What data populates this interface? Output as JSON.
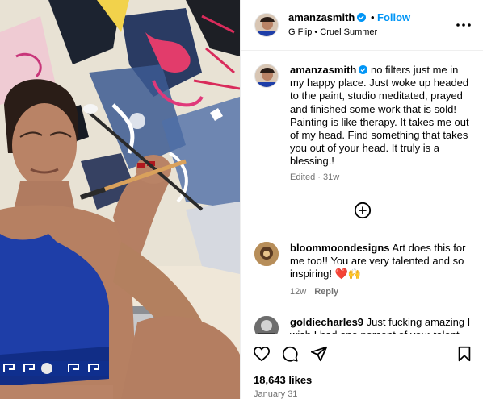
{
  "post": {
    "username": "amanzasmith",
    "follow_label": "Follow",
    "separator": "•",
    "audio": "G Flip • Cruel Summer"
  },
  "caption": {
    "username": "amanzasmith",
    "text": "no filters just me in my happy place. Just woke up headed to the paint, studio meditated, prayed and finished some work that is sold! Painting is like therapy. It takes me out of my head. Find something that takes you out of your head. It truly is a blessing.!",
    "meta": "Edited · 31w"
  },
  "comments": [
    {
      "username": "bloommoondesigns",
      "text": "Art does this for me too!! You are very talented and so inspiring! ❤️🙌",
      "age": "12w",
      "reply_label": "Reply"
    },
    {
      "username": "goldiecharles9",
      "text": "Just fucking amazing I wish I had one percent of your talent"
    }
  ],
  "footer": {
    "likes": "18,643 likes",
    "date": "January 31"
  },
  "icons": {
    "more": "more-options-icon",
    "add_comment": "add-circle-icon",
    "like": "heart-icon",
    "comment": "comment-icon",
    "share": "share-icon",
    "save": "bookmark-icon",
    "verified": "verified-badge-icon"
  },
  "colors": {
    "accent": "#0095f6",
    "verified": "#0095f6",
    "muted": "#737373",
    "divider": "#efefef"
  }
}
